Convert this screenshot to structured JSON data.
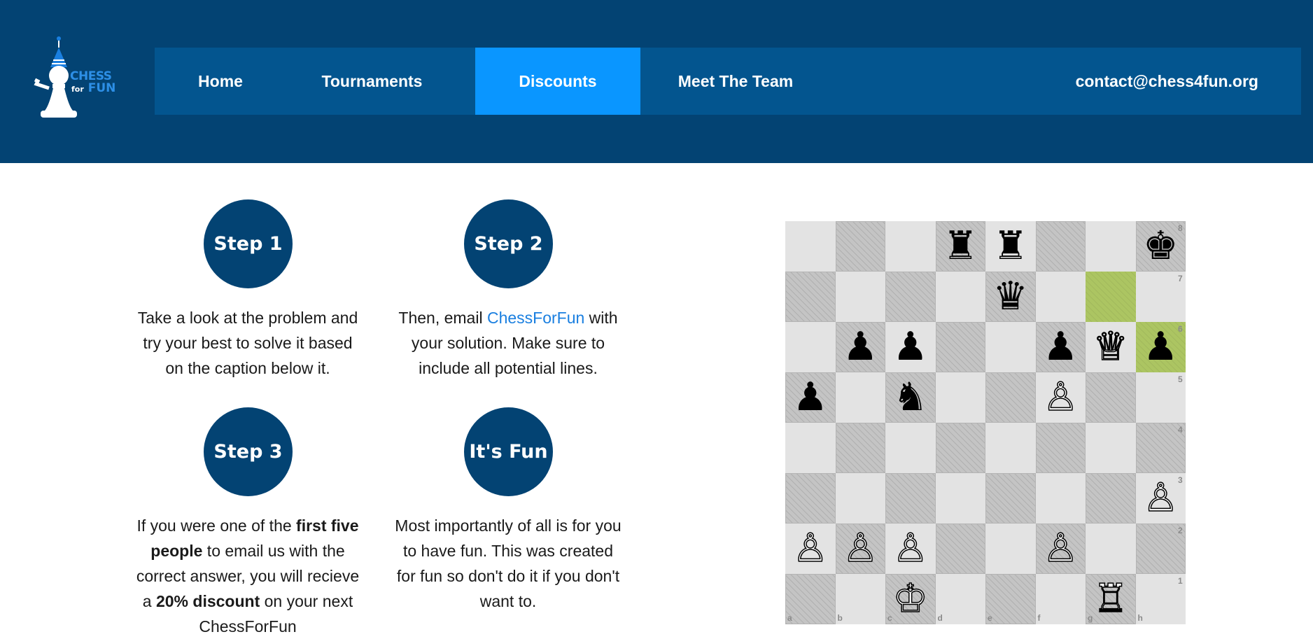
{
  "logo": {
    "line1": "CHESS",
    "line2_small": "for",
    "line2": "FUN",
    "icon": "bishop-party-hat-icon"
  },
  "nav": {
    "items": [
      {
        "label": "Home",
        "active": false
      },
      {
        "label": "Tournaments",
        "active": false
      },
      {
        "label": "Discounts",
        "active": true
      },
      {
        "label": "Meet The Team",
        "active": false
      }
    ],
    "contact": "contact@chess4fun.org"
  },
  "steps": [
    {
      "title": "Step 1",
      "text": "Take a look at the problem and try your best to solve it based on the caption below it."
    },
    {
      "title": "Step 2",
      "text_before": "Then, email ",
      "link": "ChessForFun",
      "text_after": " with your solution. Make sure to include all potential lines."
    },
    {
      "title": "Step 3",
      "t1": "If you were one of the ",
      "b1": "first five people",
      "t2": " to email us with the correct answer, you will recieve a ",
      "b2": "20% discount",
      "t3": " on your next ChessForFun"
    },
    {
      "title": "It's Fun",
      "text": "Most importantly of all is for you to have fun. This was created for fun so don't do it if you don't want to."
    }
  ],
  "board": {
    "ranks": [
      "8",
      "7",
      "6",
      "5",
      "4",
      "3",
      "2",
      "1"
    ],
    "files": [
      "a",
      "b",
      "c",
      "d",
      "e",
      "f",
      "g",
      "h"
    ],
    "highlight": [
      "g7",
      "h6"
    ],
    "pieces": {
      "d8": "♜",
      "e8": "♜",
      "h8": "♚",
      "e7": "♛",
      "b6": "♟",
      "c6": "♟",
      "f6": "♟",
      "g6": "♕",
      "h6": "♟",
      "a5": "♟",
      "c5": "♞",
      "f5": "♙",
      "h3": "♙",
      "a2": "♙",
      "b2": "♙",
      "c2": "♙",
      "f2": "♙",
      "c1": "♔",
      "g1": "♖"
    }
  }
}
